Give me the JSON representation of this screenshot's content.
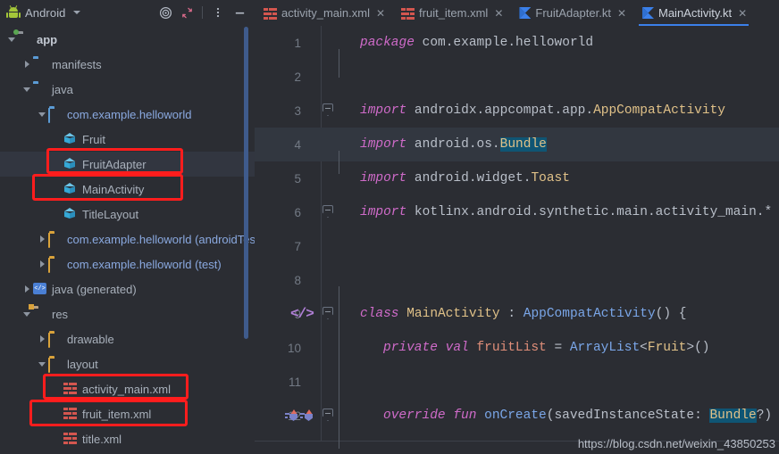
{
  "sidebar": {
    "title": "Android",
    "title_icon": "android-robot-icon",
    "toolbar": [
      {
        "name": "locate-target-icon",
        "glyph": "◎"
      },
      {
        "name": "collapse-all-icon",
        "glyph": "↙↗"
      },
      {
        "name": "more-options-icon",
        "glyph": "⋮"
      },
      {
        "name": "hide-panel-icon",
        "glyph": "—"
      }
    ],
    "tree": [
      {
        "label": "app",
        "icon": "folder-module-icon",
        "indent": 0,
        "twisty": "down",
        "style": "bold"
      },
      {
        "label": "manifests",
        "icon": "folder-icon",
        "indent": 1,
        "twisty": "right",
        "style": "normal"
      },
      {
        "label": "java",
        "icon": "folder-icon",
        "indent": 1,
        "twisty": "down",
        "style": "normal"
      },
      {
        "label": "com.example.helloworld",
        "icon": "folder-outline-icon",
        "indent": 2,
        "twisty": "down",
        "style": "package"
      },
      {
        "label": "Fruit",
        "icon": "kotlin-class-icon",
        "indent": 3,
        "twisty": "none",
        "style": "normal"
      },
      {
        "label": "FruitAdapter",
        "icon": "kotlin-class-icon",
        "indent": 3,
        "twisty": "none",
        "style": "normal",
        "selected": true,
        "highlighted": true
      },
      {
        "label": "MainActivity",
        "icon": "kotlin-class-icon",
        "indent": 3,
        "twisty": "none",
        "style": "normal",
        "highlighted": true
      },
      {
        "label": "TitleLayout",
        "icon": "kotlin-class-icon",
        "indent": 3,
        "twisty": "none",
        "style": "normal"
      },
      {
        "label": "com.example.helloworld (androidTest)",
        "icon": "folder-yellow-icon",
        "indent": 2,
        "twisty": "right",
        "style": "package"
      },
      {
        "label": "com.example.helloworld (test)",
        "icon": "folder-yellow-icon",
        "indent": 2,
        "twisty": "right",
        "style": "package"
      },
      {
        "label": "java (generated)",
        "icon": "generated-source-icon",
        "indent": 1,
        "twisty": "right",
        "style": "normal"
      },
      {
        "label": "res",
        "icon": "folder-res-icon",
        "indent": 1,
        "twisty": "down",
        "style": "normal"
      },
      {
        "label": "drawable",
        "icon": "folder-yellow-icon",
        "indent": 2,
        "twisty": "right",
        "style": "normal"
      },
      {
        "label": "layout",
        "icon": "folder-yellow-icon",
        "indent": 2,
        "twisty": "down",
        "style": "normal"
      },
      {
        "label": "activity_main.xml",
        "icon": "xml-layout-icon",
        "indent": 3,
        "twisty": "none",
        "style": "normal",
        "highlighted": true
      },
      {
        "label": "fruit_item.xml",
        "icon": "xml-layout-icon",
        "indent": 3,
        "twisty": "none",
        "style": "normal",
        "highlighted": true
      },
      {
        "label": "title.xml",
        "icon": "xml-layout-icon",
        "indent": 3,
        "twisty": "none",
        "style": "normal"
      }
    ]
  },
  "tabs": [
    {
      "label": "activity_main.xml",
      "icon": "xml-layout-icon",
      "active": false
    },
    {
      "label": "fruit_item.xml",
      "icon": "xml-layout-icon",
      "active": false
    },
    {
      "label": "FruitAdapter.kt",
      "icon": "kotlin-file-icon",
      "active": false
    },
    {
      "label": "MainActivity.kt",
      "icon": "kotlin-file-icon",
      "active": true
    }
  ],
  "tab_close_glyph": "✕",
  "editor": {
    "current_line": 4,
    "lines": [
      {
        "n": "1",
        "tokens": [
          {
            "t": "package ",
            "c": "kw"
          },
          {
            "t": "com.example.helloworld",
            "c": "plain"
          }
        ]
      },
      {
        "n": "2",
        "tokens": []
      },
      {
        "n": "3",
        "fold": true,
        "tokens": [
          {
            "t": "import ",
            "c": "kw"
          },
          {
            "t": "androidx.appcompat.app.",
            "c": "plain"
          },
          {
            "t": "AppCompatActivity",
            "c": "cls"
          }
        ]
      },
      {
        "n": "4",
        "current": true,
        "tokens": [
          {
            "t": "import ",
            "c": "kw"
          },
          {
            "t": "android.os.",
            "c": "plain"
          },
          {
            "t": "Bundle",
            "c": "sel-tok"
          }
        ]
      },
      {
        "n": "5",
        "tokens": [
          {
            "t": "import ",
            "c": "kw"
          },
          {
            "t": "android.widget.",
            "c": "plain"
          },
          {
            "t": "Toast",
            "c": "cls"
          }
        ]
      },
      {
        "n": "6",
        "fold": true,
        "tokens": [
          {
            "t": "import ",
            "c": "kw"
          },
          {
            "t": "kotlinx.android.synthetic.main.activity_main.*",
            "c": "plain"
          }
        ]
      },
      {
        "n": "7",
        "tokens": []
      },
      {
        "n": "8",
        "tokens": []
      },
      {
        "n": "9",
        "fold": true,
        "glyph": "code-brackets-icon",
        "tokens": [
          {
            "t": "class ",
            "c": "kw"
          },
          {
            "t": "MainActivity ",
            "c": "cls"
          },
          {
            "t": ": ",
            "c": "op"
          },
          {
            "t": "AppCompatActivity",
            "c": "typ"
          },
          {
            "t": "() {",
            "c": "op"
          }
        ]
      },
      {
        "n": "10",
        "indent": 1,
        "tokens": [
          {
            "t": "private val ",
            "c": "kw"
          },
          {
            "t": "fruitList ",
            "c": "fld"
          },
          {
            "t": "= ",
            "c": "op"
          },
          {
            "t": "ArrayList",
            "c": "typ"
          },
          {
            "t": "<",
            "c": "op"
          },
          {
            "t": "Fruit",
            "c": "cls"
          },
          {
            "t": ">()",
            "c": "op"
          }
        ]
      },
      {
        "n": "11",
        "tokens": []
      },
      {
        "n": "12",
        "indent": 1,
        "fold": true,
        "glyph": "override-marker-icon",
        "tokens": [
          {
            "t": "override fun ",
            "c": "kw"
          },
          {
            "t": "onCreate",
            "c": "fn"
          },
          {
            "t": "(savedInstanceState: ",
            "c": "op"
          },
          {
            "t": "Bundle",
            "c": "sel-tok"
          },
          {
            "t": "?) ",
            "c": "op"
          }
        ]
      }
    ]
  },
  "watermark": "https://blog.csdn.net/weixin_43850253",
  "colors": {
    "background": "#2b2d33",
    "accent_blue": "#3b80ea",
    "annotation_red": "#ff1d1d",
    "selection_teal": "#0f5574",
    "android_green": "#a4c639"
  }
}
